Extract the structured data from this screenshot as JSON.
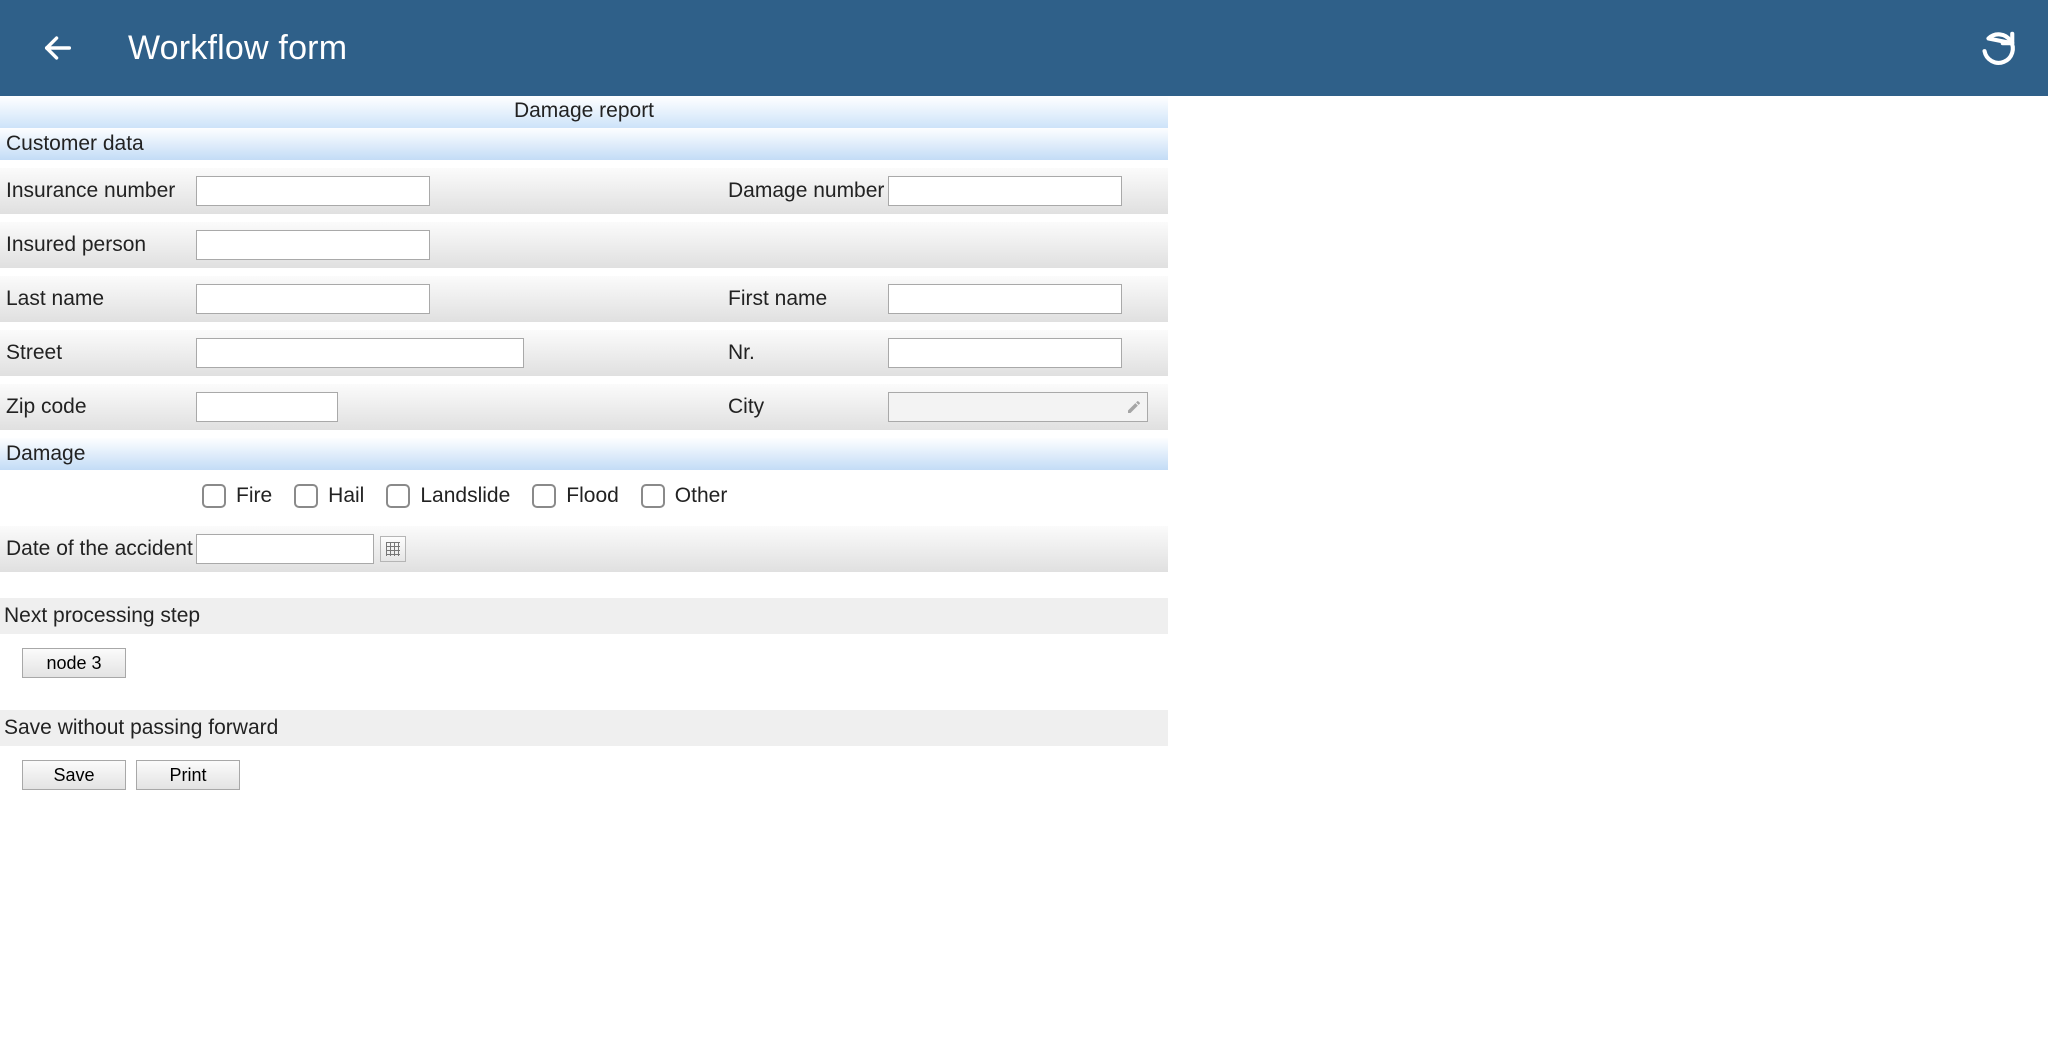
{
  "appbar": {
    "title": "Workflow form"
  },
  "form": {
    "title": "Damage report"
  },
  "sections": {
    "customer": "Customer data",
    "damage": "Damage"
  },
  "labels": {
    "insurance_number": "Insurance number",
    "damage_number": "Damage number",
    "insured_person": "Insured person",
    "last_name": "Last name",
    "first_name": "First name",
    "street": "Street",
    "nr": "Nr.",
    "zip": "Zip code",
    "city": "City",
    "accident_date": "Date of the accident"
  },
  "values": {
    "insurance_number": "",
    "damage_number": "",
    "insured_person": "",
    "last_name": "",
    "first_name": "",
    "street": "",
    "nr": "",
    "zip": "",
    "city": "",
    "accident_date": ""
  },
  "damage_types": {
    "fire": "Fire",
    "hail": "Hail",
    "landslide": "Landslide",
    "flood": "Flood",
    "other": "Other"
  },
  "next_step": {
    "heading": "Next processing step",
    "button": "node 3"
  },
  "save_section": {
    "heading": "Save without passing forward",
    "save": "Save",
    "print": "Print"
  }
}
